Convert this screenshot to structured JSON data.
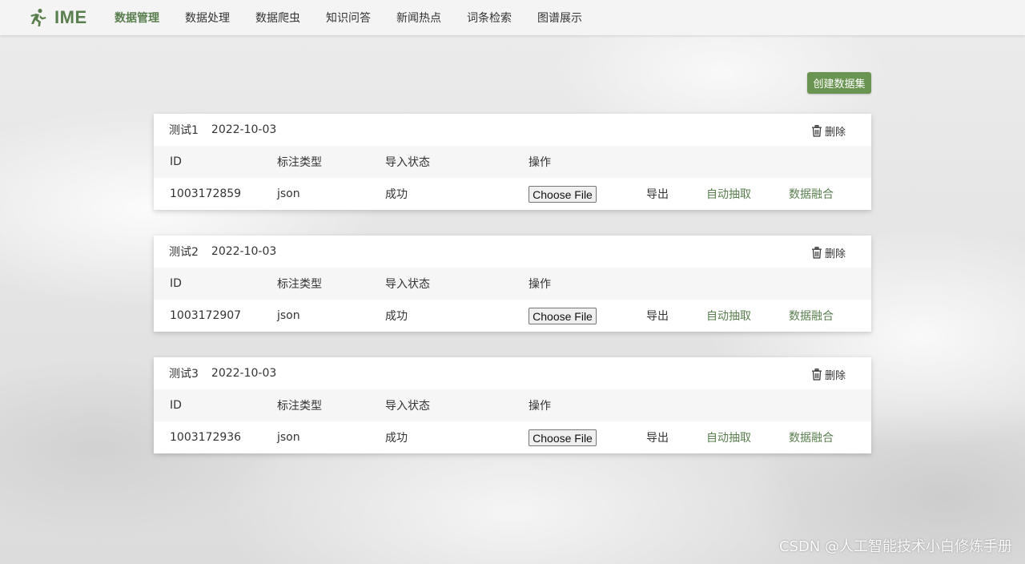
{
  "brand": {
    "logo_text": "IME",
    "accent": "#5a7f4f",
    "logo_icon": "running-figure-icon"
  },
  "nav": {
    "items": [
      {
        "label": "数据管理",
        "active": true
      },
      {
        "label": "数据处理",
        "active": false
      },
      {
        "label": "数据爬虫",
        "active": false
      },
      {
        "label": "知识问答",
        "active": false
      },
      {
        "label": "新闻热点",
        "active": false
      },
      {
        "label": "词条检索",
        "active": false
      },
      {
        "label": "图谱展示",
        "active": false
      }
    ]
  },
  "create_button": {
    "label": "创建数据集",
    "color": "#6a9451"
  },
  "table_headers": {
    "id": "ID",
    "type": "标注类型",
    "status": "导入状态",
    "op": "操作"
  },
  "actions": {
    "choose_file": "Choose File",
    "export": "导出",
    "auto_extract": "自动抽取",
    "data_merge": "数据融合",
    "delete": "删除",
    "delete_icon": "trash-icon"
  },
  "datasets": [
    {
      "name": "测试1",
      "date": "2022-10-03",
      "id": "1003172859",
      "type": "json",
      "status": "成功"
    },
    {
      "name": "测试2",
      "date": "2022-10-03",
      "id": "1003172907",
      "type": "json",
      "status": "成功"
    },
    {
      "name": "测试3",
      "date": "2022-10-03",
      "id": "1003172936",
      "type": "json",
      "status": "成功"
    }
  ],
  "watermark": "CSDN @人工智能技术小白修炼手册"
}
